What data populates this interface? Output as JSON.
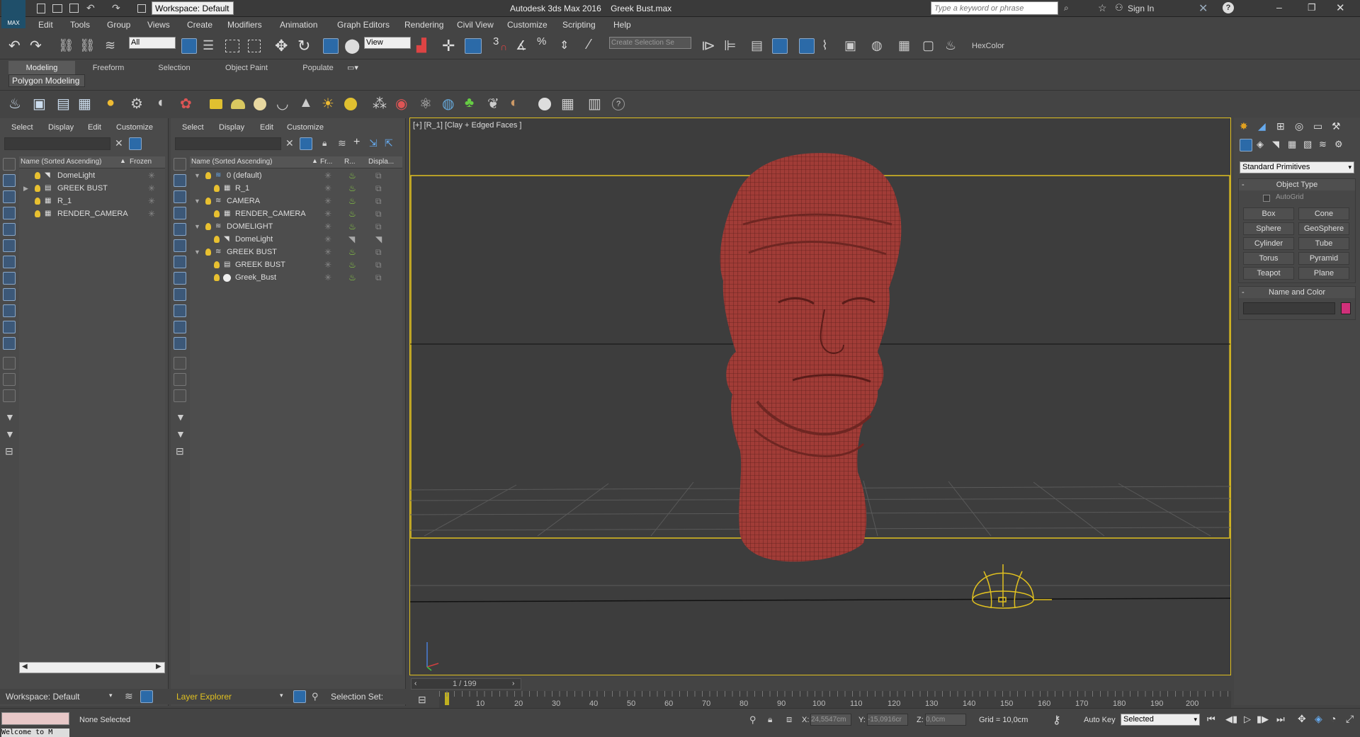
{
  "title_bar": {
    "app": "Autodesk 3ds Max 2016",
    "file": "Greek Bust.max",
    "workspace": "Workspace: Default",
    "search_placeholder": "Type a keyword or phrase",
    "sign_in": "Sign In",
    "logo": "MAX"
  },
  "menu": [
    "Edit",
    "Tools",
    "Group",
    "Views",
    "Create",
    "Modifiers",
    "Animation",
    "Graph Editors",
    "Rendering",
    "Civil View",
    "Customize",
    "Scripting",
    "Help"
  ],
  "toolbar": {
    "selection_filter": "All",
    "ref_coord": "View",
    "create_selection_set": "Create Selection Se",
    "hexcolor": "HexColor",
    "snap_numbers": [
      "3",
      "%"
    ]
  },
  "ribbon_tabs": [
    "Modeling",
    "Freeform",
    "Selection",
    "Object Paint",
    "Populate"
  ],
  "ribbon_panel": "Polygon Modeling",
  "left_explorer": {
    "menu": [
      "Select",
      "Display",
      "Edit",
      "Customize"
    ],
    "col_name": "Name (Sorted Ascending)",
    "col_frozen": "Frozen",
    "rows": [
      "DomeLight",
      "GREEK BUST",
      "R_1",
      "RENDER_CAMERA"
    ],
    "footer": "Workspace: Default"
  },
  "layer_explorer": {
    "menu": [
      "Select",
      "Display",
      "Edit",
      "Customize"
    ],
    "col_name": "Name (Sorted Ascending)",
    "col_fr": "Fr...",
    "col_r": "R...",
    "col_disp": "Displa...",
    "rows": [
      {
        "name": "0 (default)",
        "level": 0
      },
      {
        "name": "R_1",
        "level": 1
      },
      {
        "name": "CAMERA",
        "level": 0
      },
      {
        "name": "RENDER_CAMERA",
        "level": 1
      },
      {
        "name": "DOMELIGHT",
        "level": 0
      },
      {
        "name": "DomeLight",
        "level": 1
      },
      {
        "name": "GREEK BUST",
        "level": 0
      },
      {
        "name": "GREEK BUST",
        "level": 1
      },
      {
        "name": "Greek_Bust",
        "level": 1
      }
    ],
    "footer": "Layer Explorer",
    "selection_set": "Selection Set:"
  },
  "viewport": {
    "label": "[+] [R_1] [Clay + Edged Faces ]",
    "frame": "1 / 199"
  },
  "timeline": {
    "ticks": [
      "10",
      "20",
      "30",
      "40",
      "50",
      "60",
      "70",
      "80",
      "90",
      "100",
      "110",
      "120",
      "130",
      "140",
      "150",
      "160",
      "170",
      "180",
      "190",
      "200"
    ]
  },
  "command_panel": {
    "dropdown": "Standard Primitives",
    "object_type": "Object Type",
    "autogrid": "AutoGrid",
    "buttons": [
      "Box",
      "Cone",
      "Sphere",
      "GeoSphere",
      "Cylinder",
      "Tube",
      "Torus",
      "Pyramid",
      "Teapot",
      "Plane"
    ],
    "name_color": "Name and Color",
    "swatch": "#d0307a"
  },
  "status": {
    "selection": "None Selected",
    "x_label": "X:",
    "x": "24,5547cm",
    "y_label": "Y:",
    "y": "-15,0916cr",
    "z_label": "Z:",
    "z": "0,0cm",
    "grid": "Grid = 10,0cm",
    "auto_key": "Auto Key",
    "key_mode": "Selected",
    "prompt": "Welcome to M"
  },
  "colors": {
    "accent_blue": "#2b6aa8",
    "gizmo_yellow": "#e0c020",
    "bust": "#9a3a35"
  }
}
